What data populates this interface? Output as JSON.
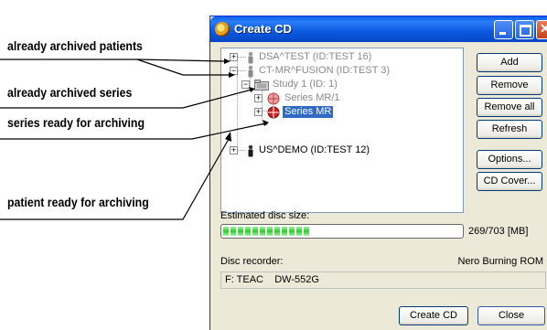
{
  "annotations": [
    "already archived patients",
    "already archived series",
    "series ready for archiving",
    "patient ready for archiving"
  ],
  "window": {
    "title": "Create CD",
    "title_icon": "cd-icon"
  },
  "tree": {
    "patient1": "DSA^TEST (ID:TEST 16)",
    "patient2": "CT-MR^FUSION (ID:TEST 3)",
    "study1": "Study 1 (ID: 1)",
    "series1": "Series MR/1",
    "series2": "Series MR",
    "patient3": "US^DEMO (ID:TEST 12)"
  },
  "buttons": {
    "add": "Add",
    "remove": "Remove",
    "remove_all": "Remove all",
    "refresh": "Refresh",
    "options": "Options...",
    "cd_cover": "CD Cover...",
    "create_cd": "Create CD",
    "close": "Close"
  },
  "disc": {
    "estimated_label": "Estimated disc size:",
    "size_text": "269/703 [MB]",
    "fill_fraction": 0.383,
    "recorder_label": "Disc recorder:",
    "recorder_software": "Nero Burning ROM",
    "drive": "F: TEAC    DW-552G"
  },
  "colors": {
    "selection": "#316ac5",
    "progress": "#2fcc2f",
    "titlebar": "#0a58e0"
  }
}
